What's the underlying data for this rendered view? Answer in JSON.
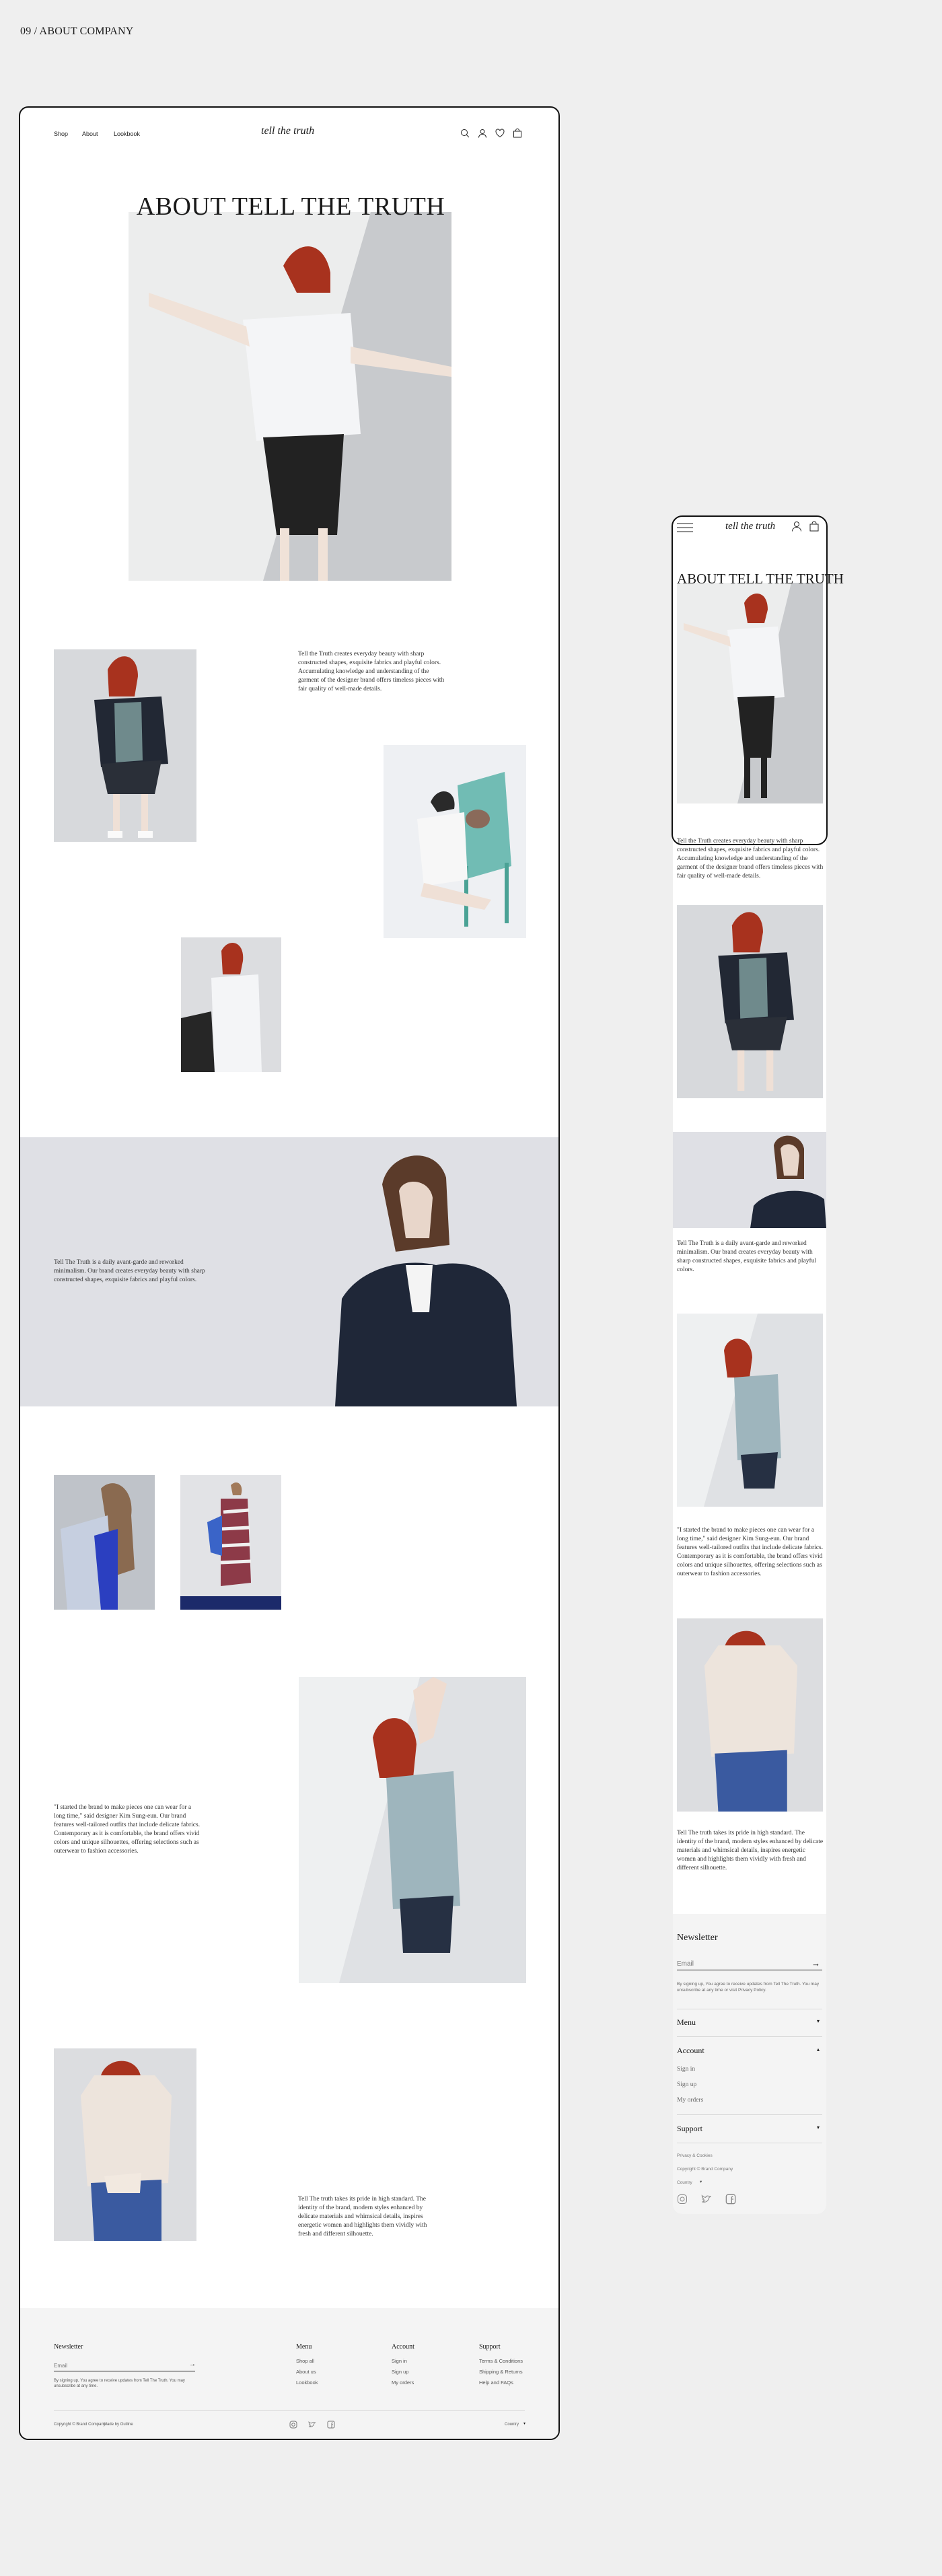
{
  "page_label": "09 / ABOUT COMPANY",
  "desktop": {
    "nav": {
      "shop": "Shop",
      "about": "About",
      "lookbook": "Lookbook"
    },
    "logo": "tell the truth",
    "hero_title": "ABOUT TELL THE TRUTH",
    "para1": "Tell the Truth creates everyday beauty with sharp constructed shapes, exquisite fabrics and playful colors. Accumulating knowledge and understanding of the garment of the designer brand offers timeless pieces with fair quality of well-made details.",
    "para2": "Tell The Truth is a daily avant-garde and reworked minimalism. Our brand creates everyday beauty with sharp constructed shapes, exquisite fabrics and playful colors.",
    "para3": "\"I started the brand to make pieces one can wear for a long time,\" said designer Kim Sung-eun. Our brand features well-tailored outfits that include delicate fabrics. Contemporary as it is comfortable, the brand offers vivid colors and unique silhouettes, offering selections such as outerwear to fashion accessories.",
    "para4": "Tell The truth takes its pride in high standard. The identity of the brand, modern styles enhanced by delicate materials and whimsical details, inspires energetic women and highlights them vividly with fresh and different silhouette.",
    "footer": {
      "newsletter": "Newsletter",
      "email_placeholder": "Email",
      "consent": "By signing up, You agree to receive updates from Tell The Truth. You may unsubscribe at any time.",
      "menu": "Menu",
      "menu_items": [
        "Shop all",
        "About us",
        "Lookbook"
      ],
      "account": "Account",
      "account_items": [
        "Sign in",
        "Sign up",
        "My orders"
      ],
      "support": "Support",
      "support_items": [
        "Terms & Conditions",
        "Shipping & Returns",
        "Help and FAQs"
      ],
      "copyright": "Copyright © Brand Company",
      "made_by": "Made by Outline",
      "country": "Country"
    }
  },
  "mobile": {
    "logo": "tell the truth",
    "hero_title": "ABOUT TELL THE TRUTH",
    "para1": "Tell the Truth creates everyday beauty with sharp constructed shapes, exquisite fabrics and playful colors. Accumulating knowledge and understanding of the garment of the designer brand offers timeless pieces with fair quality of well-made details.",
    "para2": "Tell The Truth is a daily avant-garde and reworked minimalism. Our brand creates everyday beauty with sharp constructed shapes, exquisite fabrics and playful colors.",
    "para3": "\"I started the brand to make pieces one can wear for a long time,\" said designer Kim Sung-eun. Our brand features well-tailored outfits that include delicate fabrics. Contemporary as it is comfortable, the brand offers vivid colors and unique silhouettes, offering selections such as outerwear to fashion accessories.",
    "para4": "Tell The truth takes its pride in high standard. The identity of the brand, modern styles enhanced by delicate materials and whimsical details, inspires energetic women and highlights them vividly with fresh and different silhouette.",
    "newsletter": "Newsletter",
    "email_placeholder": "Email",
    "consent": "By signing up, You agree to receive updates from Tell The Truth. You may unsubscribe at any time or visit Privacy Policy.",
    "menu": "Menu",
    "account": "Account",
    "account_items": [
      "Sign in",
      "Sign up",
      "My orders"
    ],
    "support": "Support",
    "privacy": "Privacy & Cookies",
    "copyright": "Copyright © Brand Company",
    "country": "Country"
  }
}
